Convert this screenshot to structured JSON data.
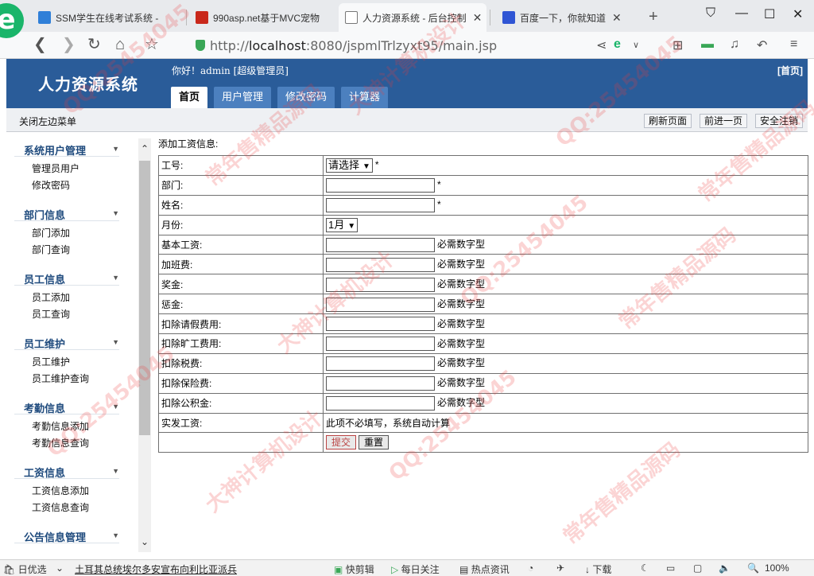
{
  "browser": {
    "tabs": [
      {
        "title": "SSM学生在线考试系统 -",
        "favicon": "code-icon",
        "color": "#2f7fd8"
      },
      {
        "title": "990asp.net基于MVC宠物",
        "favicon": "red-square-icon",
        "color": "#c9281b"
      },
      {
        "title": "人力资源系统 - 后台控制",
        "favicon": "page-icon",
        "color": "#ffffff"
      },
      {
        "title": "百度一下，你就知道",
        "favicon": "paw-icon",
        "color": "#2f55d4"
      }
    ],
    "url_prefix": "http://",
    "url_host": "localhost",
    "url_rest": ":8080/jspmlTrlzyxt95/main.jsp"
  },
  "app": {
    "title": "人力资源系统",
    "greeting": "你好！admin [超级管理员]",
    "home_link": "[首页]",
    "nav": [
      "首页",
      "用户管理",
      "修改密码",
      "计算器"
    ],
    "toggle_menu": "关闭左边菜单",
    "toolbar": [
      "刷新页面",
      "前进一页",
      "安全注销"
    ]
  },
  "sidebar": [
    {
      "title": "系统用户管理",
      "items": [
        "管理员用户",
        "修改密码"
      ]
    },
    {
      "title": "部门信息",
      "items": [
        "部门添加",
        "部门查询"
      ]
    },
    {
      "title": "员工信息",
      "items": [
        "员工添加",
        "员工查询"
      ]
    },
    {
      "title": "员工维护",
      "items": [
        "员工维护",
        "员工维护查询"
      ]
    },
    {
      "title": "考勤信息",
      "items": [
        "考勤信息添加",
        "考勤信息查询"
      ]
    },
    {
      "title": "工资信息",
      "items": [
        "工资信息添加",
        "工资信息查询"
      ]
    },
    {
      "title": "公告信息管理",
      "items": []
    }
  ],
  "form": {
    "title": "添加工资信息:",
    "fields": [
      {
        "label": "工号:",
        "type": "select",
        "value": "请选择",
        "suffix": "*"
      },
      {
        "label": "部门:",
        "type": "text",
        "value": "",
        "suffix": "*"
      },
      {
        "label": "姓名:",
        "type": "text",
        "value": "",
        "suffix": "*"
      },
      {
        "label": "月份:",
        "type": "select",
        "value": "1月",
        "suffix": ""
      },
      {
        "label": "基本工资:",
        "type": "text",
        "value": "",
        "suffix": "必需数字型"
      },
      {
        "label": "加班费:",
        "type": "text",
        "value": "",
        "suffix": "必需数字型"
      },
      {
        "label": "奖金:",
        "type": "text",
        "value": "",
        "suffix": "必需数字型"
      },
      {
        "label": "惩金:",
        "type": "text",
        "value": "",
        "suffix": "必需数字型"
      },
      {
        "label": "扣除请假费用:",
        "type": "text",
        "value": "",
        "suffix": "必需数字型"
      },
      {
        "label": "扣除旷工费用:",
        "type": "text",
        "value": "",
        "suffix": "必需数字型"
      },
      {
        "label": "扣除税费:",
        "type": "text",
        "value": "",
        "suffix": "必需数字型"
      },
      {
        "label": "扣除保险费:",
        "type": "text",
        "value": "",
        "suffix": "必需数字型"
      },
      {
        "label": "扣除公积金:",
        "type": "text",
        "value": "",
        "suffix": "必需数字型"
      },
      {
        "label": "实发工资:",
        "type": "note",
        "value": "此项不必填写，系统自动计算",
        "suffix": ""
      }
    ],
    "submit_label": "提交",
    "reset_label": "重置"
  },
  "statusbar": {
    "left": "日优选",
    "news": "土耳其总统埃尔多安宣布向利比亚派兵",
    "items": [
      "快剪辑",
      "每日关注",
      "热点资讯",
      "下载"
    ],
    "zoom": "100%"
  },
  "watermark": [
    "QQ:25454045",
    "常年售精品源码",
    "大神计算机设计",
    "QQ:25454045",
    "常年售精品源码",
    "大神计算机设计",
    "QQ:25454045",
    "常年售精品源码",
    "QQ:25454045",
    "大神计算机设计",
    "QQ:25454045",
    "常年售精品源码"
  ]
}
